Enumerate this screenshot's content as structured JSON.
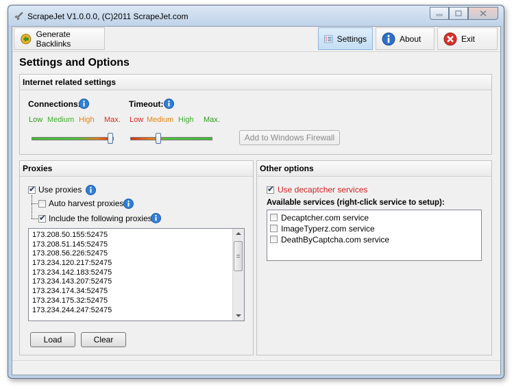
{
  "window": {
    "title": "ScrapeJet V1.0.0.0, (C)2011 ScrapeJet.com"
  },
  "toolbar": {
    "generate_label": "Generate Backlinks",
    "settings_label": "Settings",
    "about_label": "About",
    "exit_label": "Exit"
  },
  "page": {
    "title": "Settings and Options"
  },
  "internet": {
    "header": "Internet related settings",
    "connections_label": "Connections:",
    "timeout_label": "Timeout:",
    "connections_levels": [
      "Low",
      "Medium",
      "High",
      "Max."
    ],
    "timeout_levels": [
      "Low",
      "Medium",
      "High",
      "Max."
    ],
    "connections_value": 1.0,
    "timeout_value": 0.33,
    "firewall_button": "Add to Windows Firewall"
  },
  "proxies": {
    "header": "Proxies",
    "use_proxies_label": "Use proxies",
    "use_proxies_checked": true,
    "auto_harvest_label": "Auto harvest proxies",
    "auto_harvest_checked": false,
    "include_label": "Include the following proxies",
    "include_checked": true,
    "list": [
      "173.208.50.155:52475",
      "173.208.51.145:52475",
      "173.208.56.226:52475",
      "173.234.120.217:52475",
      "173.234.142.183:52475",
      "173.234.143.207:52475",
      "173.234.174.34:52475",
      "173.234.175.32:52475",
      "173.234.244.247:52475"
    ],
    "load_button": "Load",
    "clear_button": "Clear"
  },
  "other": {
    "header": "Other options",
    "decaptcher_label": "Use decaptcher services",
    "decaptcher_checked": true,
    "available_label": "Available services (right-click service to setup):",
    "services": [
      {
        "label": "Decaptcher.com service",
        "checked": false
      },
      {
        "label": "ImageTyperz.com service",
        "checked": false
      },
      {
        "label": "DeathByCaptcha.com service",
        "checked": false
      }
    ]
  },
  "colors": {
    "low": "#2c9a1a",
    "medium": "#3bb02b",
    "high": "#e8830c",
    "max": "#d8291d",
    "decaptcher_text": "#d22121"
  }
}
